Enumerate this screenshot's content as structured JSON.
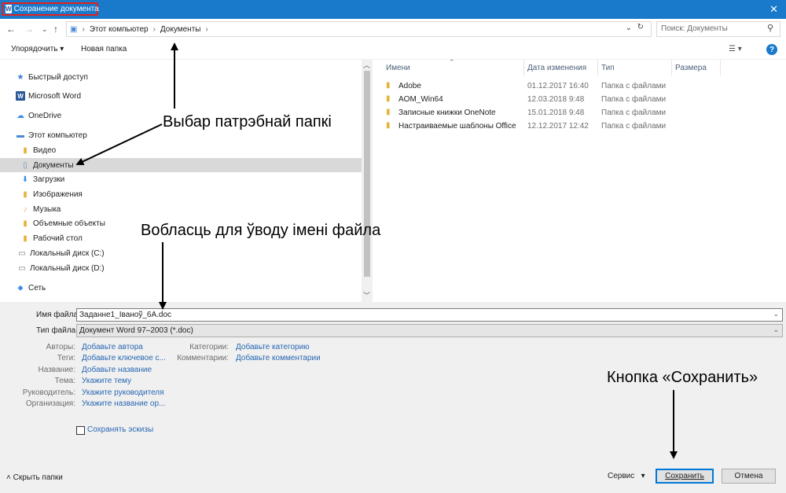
{
  "window": {
    "title": "Сохранение документа",
    "app_badge": "W",
    "close_label": "✕"
  },
  "address": {
    "breadcrumb": [
      "Этот компьютер",
      "Документы"
    ],
    "search_placeholder": "Поиск: Документы"
  },
  "toolbar": {
    "organize_label": "Упорядочить ▾",
    "new_folder_label": "Новая папка",
    "help_label": "?"
  },
  "navpane": {
    "items": [
      {
        "label": "Быстрый доступ",
        "icon": "star-icon"
      },
      {
        "label": "Microsoft Word",
        "icon": "word-icon"
      },
      {
        "label": "OneDrive",
        "icon": "cloud-icon"
      },
      {
        "label": "Этот компьютер",
        "icon": "computer-icon"
      },
      {
        "label": "Видео",
        "icon": "video-folder-icon"
      },
      {
        "label": "Документы",
        "icon": "documents-folder-icon",
        "selected": true
      },
      {
        "label": "Загрузки",
        "icon": "downloads-icon"
      },
      {
        "label": "Изображения",
        "icon": "pictures-folder-icon"
      },
      {
        "label": "Музыка",
        "icon": "music-folder-icon"
      },
      {
        "label": "Объемные объекты",
        "icon": "3d-objects-folder-icon"
      },
      {
        "label": "Рабочий стол",
        "icon": "desktop-folder-icon"
      },
      {
        "label": "Локальный диск (C:)",
        "icon": "disk-icon"
      },
      {
        "label": "Локальный диск (D:)",
        "icon": "disk-icon"
      },
      {
        "label": "Сеть",
        "icon": "network-icon"
      }
    ]
  },
  "filelist": {
    "columns": [
      "Имени",
      "Дата изменения",
      "Тип",
      "Размера"
    ],
    "rows": [
      {
        "name": "Adobe",
        "date": "01.12.2017 16:40",
        "type": "Папка с файлами"
      },
      {
        "name": "AOM_Win64",
        "date": "12.03.2018 9:48",
        "type": "Папка с файлами"
      },
      {
        "name": "Записные книжки OneNote",
        "date": "15.01.2018 9:48",
        "type": "Папка с файлами"
      },
      {
        "name": "Настраиваемые шаблоны Office",
        "date": "12.12.2017 12:42",
        "type": "Папка с файлами"
      }
    ]
  },
  "save": {
    "filename_label": "Имя файла:",
    "filename_value": "Заданне1_Іваноў_6А.doc",
    "filetype_label": "Тип файла:",
    "filetype_value": "Документ Word 97–2003 (*.doc)",
    "meta_left": [
      {
        "label": "Авторы:",
        "value": "Добавьте автора"
      },
      {
        "label": "Теги:",
        "value": "Добавьте ключевое с..."
      },
      {
        "label": "Название:",
        "value": "Добавьте название"
      },
      {
        "label": "Тема:",
        "value": "Укажите тему"
      },
      {
        "label": "Руководитель:",
        "value": "Укажите руководителя"
      },
      {
        "label": "Организация:",
        "value": "Укажите название ор..."
      }
    ],
    "meta_right": [
      {
        "label": "Категории:",
        "value": "Добавьте категорию"
      },
      {
        "label": "Комментарии:",
        "value": "Добавьте комментарии"
      }
    ],
    "thumbnails_label": "Сохранять эскизы"
  },
  "footer": {
    "hide_folders_label": "Скрыть папки",
    "service_label": "Сервис",
    "save_button": "Сохранить",
    "cancel_button": "Отмена"
  },
  "annotations": {
    "folder_choice": "Выбар патрэбнай папкі",
    "filename_area": "Вобласць для ўводу імені файла",
    "save_button_note": "Кнопка «Сохранить»"
  }
}
